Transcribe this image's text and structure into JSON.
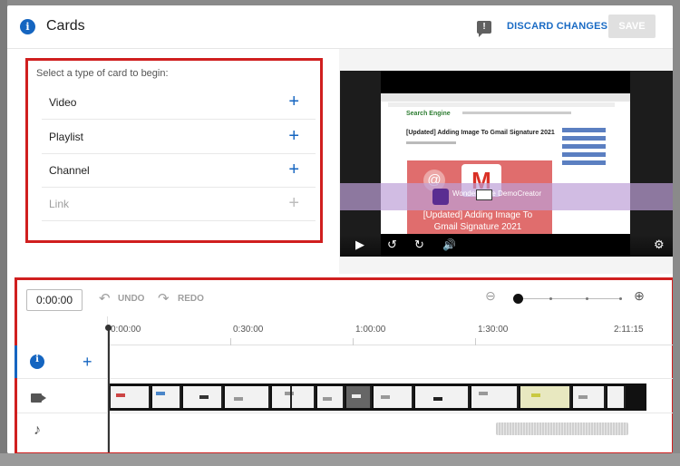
{
  "header": {
    "title": "Cards",
    "info_icon": "i",
    "feedback_icon": "!",
    "discard_label": "DISCARD CHANGES",
    "save_label": "SAVE"
  },
  "cards_panel": {
    "prompt": "Select a type of card to begin:",
    "items": [
      {
        "label": "Video",
        "enabled": true
      },
      {
        "label": "Playlist",
        "enabled": true
      },
      {
        "label": "Channel",
        "enabled": true
      },
      {
        "label": "Link",
        "enabled": false
      }
    ],
    "plus_symbol": "+"
  },
  "preview": {
    "site_logo": "Search Engine",
    "site_heading": "[Updated] Adding Image To Gmail Signature 2021",
    "hero_text": "[Updated] Adding Image To Gmail Signature 2021",
    "hero_letter": "M",
    "hero_at": "@",
    "badge_text": "Wondershare DemoCreator",
    "controls": {
      "play": "▶",
      "rewind": "↺",
      "forward": "↻",
      "volume": "🔊",
      "settings": "⚙"
    }
  },
  "timeline": {
    "current_time": "0:00:00",
    "undo_label": "UNDO",
    "redo_label": "REDO",
    "undo_icon": "↶",
    "redo_icon": "↷",
    "zoom_out_icon": "⊖",
    "zoom_in_icon": "⊕",
    "ticks": [
      "0:00:00",
      "0:30:00",
      "1:00:00",
      "1:30:00",
      "2:11:15"
    ],
    "row_info_icon": "i",
    "row_plus": "+",
    "music_icon": "♪"
  },
  "colors": {
    "accent": "#1565c0",
    "highlight_border": "#d01f1f",
    "save_disabled_bg": "#e0e0e0"
  }
}
